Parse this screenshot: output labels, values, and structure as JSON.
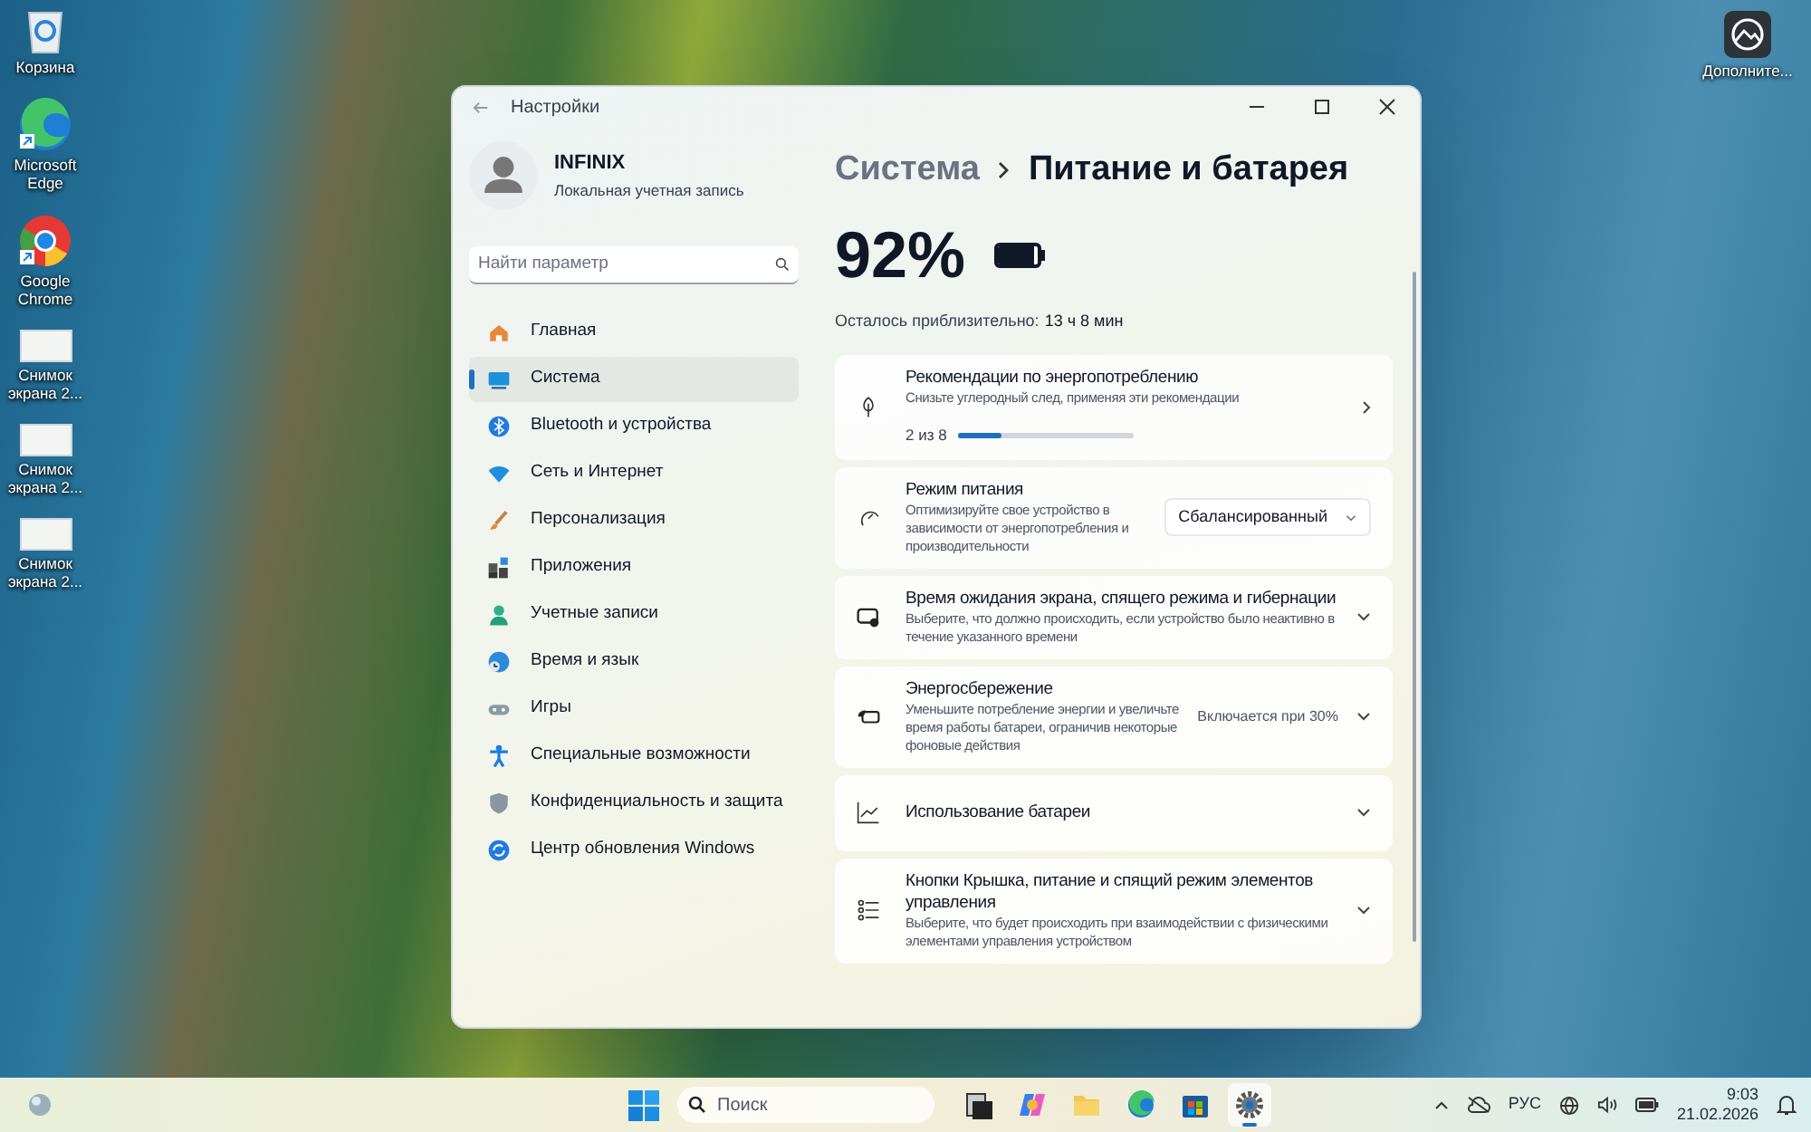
{
  "desktop_icons_left": [
    {
      "kind": "bin",
      "label": "Корзина"
    },
    {
      "kind": "edge",
      "label": "Microsoft Edge"
    },
    {
      "kind": "chrome",
      "label": "Google Chrome"
    },
    {
      "kind": "shot",
      "label": "Снимок экрана 2..."
    },
    {
      "kind": "shot",
      "label": "Снимок экрана 2..."
    },
    {
      "kind": "shot",
      "label": "Снимок экрана 2..."
    }
  ],
  "desktop_icons_right": [
    {
      "kind": "app",
      "label": "Дополните..."
    }
  ],
  "window": {
    "title": "Настройки",
    "account": {
      "name": "INFINIX",
      "type": "Локальная учетная запись"
    },
    "search": {
      "placeholder": "Найти параметр"
    },
    "nav": [
      {
        "kind": "home",
        "label": "Главная",
        "selected": false
      },
      {
        "kind": "system",
        "label": "Система",
        "selected": true
      },
      {
        "kind": "bluetooth",
        "label": "Bluetooth и устройства",
        "selected": false
      },
      {
        "kind": "wifi",
        "label": "Сеть и Интернет",
        "selected": false
      },
      {
        "kind": "brush",
        "label": "Персонализация",
        "selected": false
      },
      {
        "kind": "apps",
        "label": "Приложения",
        "selected": false
      },
      {
        "kind": "person",
        "label": "Учетные записи",
        "selected": false
      },
      {
        "kind": "globe",
        "label": "Время и язык",
        "selected": false
      },
      {
        "kind": "game",
        "label": "Игры",
        "selected": false
      },
      {
        "kind": "access",
        "label": "Специальные возможности",
        "selected": false
      },
      {
        "kind": "shield",
        "label": "Конфиденциальность и защита",
        "selected": false
      },
      {
        "kind": "update",
        "label": "Центр обновления Windows",
        "selected": false
      }
    ],
    "breadcrumb": [
      "Система",
      "Питание и батарея"
    ],
    "battery": {
      "percent": "92%",
      "level": 0.92,
      "remaining_label": "Осталось приблизительно:",
      "remaining": "13 ч 8 мин"
    },
    "cards": [
      {
        "kind": "progress",
        "title": "Рекомендации по энергопотреблению",
        "desc": "Снизьте углеродный след, применяя эти рекомендации",
        "count": "2 из 8",
        "level": 0.25
      },
      {
        "kind": "dropdown",
        "title": "Режим питания",
        "desc": "Оптимизируйте свое устройство в зависимости от энергопотребления и производительности",
        "value": "Сбалансированный"
      },
      {
        "kind": "expand",
        "title": "Время ожидания экрана, спящего режима и гибернации",
        "desc": "Выберите, что должно происходить, если устройство было неактивно в течение указанного времени"
      },
      {
        "kind": "expand",
        "title": "Энергосбережение",
        "desc": "Уменьшите потребление энергии и увеличьте время работы батареи, ограничив некоторые фоновые действия",
        "value": "Включается при 30%"
      },
      {
        "kind": "expand",
        "title": "Использование батареи"
      },
      {
        "kind": "expand",
        "title": "Кнопки Крышка, питание и спящий режим элементов управления",
        "desc": "Выберите, что будет происходить при взаимодействии с физическими элементами управления устройством"
      }
    ]
  },
  "taskbar": {
    "search_placeholder": "Поиск",
    "apps": [
      {
        "kind": "taskview",
        "selected": false
      },
      {
        "kind": "copilot",
        "selected": false
      },
      {
        "kind": "folder",
        "selected": false
      },
      {
        "kind": "edge",
        "selected": false
      },
      {
        "kind": "store",
        "selected": false
      },
      {
        "kind": "gear",
        "selected": true
      }
    ],
    "language": "РУС",
    "time": "9:03",
    "date": "21.02.2026"
  }
}
